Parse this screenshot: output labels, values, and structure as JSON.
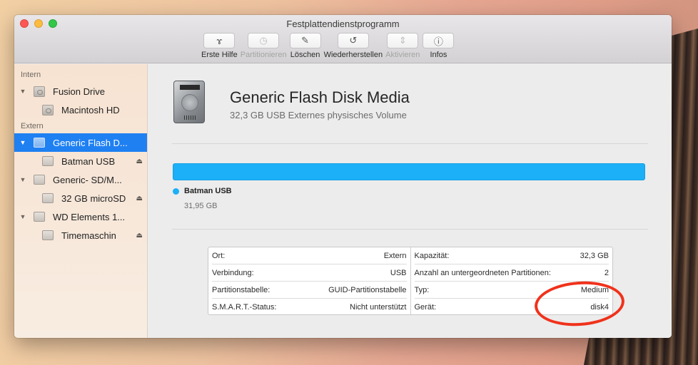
{
  "window": {
    "title": "Festplattendienstprogramm"
  },
  "toolbar": {
    "buttons": [
      {
        "label": "Erste Hilfe",
        "icon": "stethoscope-icon",
        "glyph": "ɤ",
        "enabled": true
      },
      {
        "label": "Partitionieren",
        "icon": "pie-chart-icon",
        "glyph": "◷",
        "enabled": false
      },
      {
        "label": "Löschen",
        "icon": "erase-icon",
        "glyph": "✎",
        "enabled": true
      },
      {
        "label": "Wiederherstellen",
        "icon": "restore-icon",
        "glyph": "↺",
        "enabled": true
      },
      {
        "label": "Aktivieren",
        "icon": "mount-icon",
        "glyph": "⇕",
        "enabled": false
      },
      {
        "label": "Infos",
        "icon": "info-icon",
        "glyph": "ⓘ",
        "enabled": true
      }
    ]
  },
  "sidebar": {
    "sections": [
      {
        "title": "Intern",
        "items": [
          {
            "label": "Fusion Drive",
            "level": 0,
            "expanded": true
          },
          {
            "label": "Macintosh HD",
            "level": 1
          }
        ]
      },
      {
        "title": "Extern",
        "items": [
          {
            "label": "Generic Flash D...",
            "level": 0,
            "expanded": true,
            "selected": true
          },
          {
            "label": "Batman USB",
            "level": 1,
            "eject": true
          },
          {
            "label": "Generic- SD/M...",
            "level": 0,
            "expanded": true
          },
          {
            "label": "32 GB microSD",
            "level": 1,
            "eject": true
          },
          {
            "label": "WD Elements 1...",
            "level": 0,
            "expanded": true
          },
          {
            "label": "Timemaschin",
            "level": 1,
            "eject": true
          }
        ]
      }
    ],
    "glyphs": {
      "expanded": "▼",
      "eject": "⏏"
    }
  },
  "device": {
    "name": "Generic Flash Disk Media",
    "subtitle": "32,3 GB USB Externes physisches Volume"
  },
  "usage": {
    "partition_name": "Batman USB",
    "partition_size": "31,95 GB",
    "fill_fraction": 1.0,
    "color": "#1bb0f7"
  },
  "info": {
    "left": [
      {
        "label": "Ort:",
        "value": "Extern"
      },
      {
        "label": "Verbindung:",
        "value": "USB"
      },
      {
        "label": "Partitionstabelle:",
        "value": "GUID-Partitionstabelle"
      },
      {
        "label": "S.M.A.R.T.-Status:",
        "value": "Nicht unterstützt"
      }
    ],
    "right": [
      {
        "label": "Kapazität:",
        "value": "32,3 GB"
      },
      {
        "label": "Anzahl an untergeordneten Partitionen:",
        "value": "2"
      },
      {
        "label": "Typ:",
        "value": "Medium"
      },
      {
        "label": "Gerät:",
        "value": "disk4"
      }
    ]
  },
  "annotation": {
    "color": "#f0321b",
    "target": "disk4"
  }
}
